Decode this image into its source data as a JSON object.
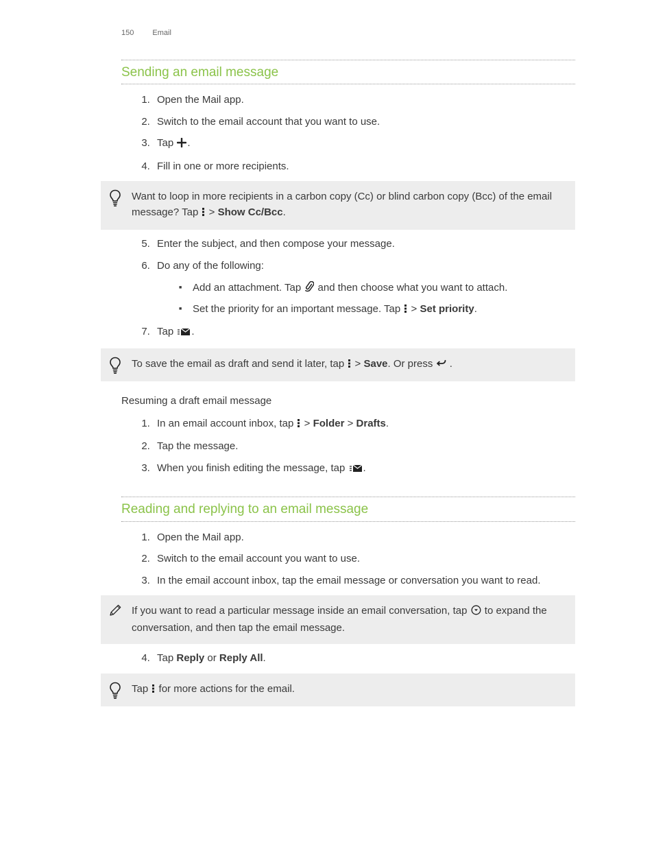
{
  "header": {
    "page_number": "150",
    "breadcrumb": "Email"
  },
  "section1": {
    "title": "Sending an email message",
    "step1": "Open the Mail app.",
    "step2": "Switch to the email account that you want to use.",
    "step3_pre": "Tap ",
    "step3_post": ".",
    "step4": "Fill in one or more recipients.",
    "tip1_pre": "Want to loop in more recipients in a carbon copy (Cc) or blind carbon copy (Bcc) of the email message? Tap ",
    "tip1_mid": " > ",
    "tip1_bold": "Show Cc/Bcc",
    "tip1_post": ".",
    "step5": "Enter the subject, and then compose your message.",
    "step6": "Do any of the following:",
    "step6a_pre": "Add an attachment. Tap ",
    "step6a_post": " and then choose what you want to attach.",
    "step6b_pre": "Set the priority for an important message. Tap ",
    "step6b_mid": " > ",
    "step6b_bold": "Set priority",
    "step6b_post": ".",
    "step7_pre": "Tap ",
    "step7_post": ".",
    "tip2_pre": "To save the email as draft and send it later, tap ",
    "tip2_mid": " > ",
    "tip2_bold": "Save",
    "tip2_post1": ". Or press ",
    "tip2_post2": " ."
  },
  "sub1": {
    "heading": "Resuming a draft email message",
    "step1_pre": "In an email account inbox, tap ",
    "step1_mid": " > ",
    "step1_b1": "Folder",
    "step1_sep": " > ",
    "step1_b2": "Drafts",
    "step1_post": ".",
    "step2": "Tap the message.",
    "step3_pre": "When you finish editing the message, tap ",
    "step3_post": "."
  },
  "section2": {
    "title": "Reading and replying to an email message",
    "step1": "Open the Mail app.",
    "step2": "Switch to the email account you want to use.",
    "step3": "In the email account inbox, tap the email message or conversation you want to read.",
    "note_pre": "If you want to read a particular message inside an email conversation, tap ",
    "note_post": " to expand the conversation, and then tap the email message.",
    "step4_pre": "Tap ",
    "step4_b1": "Reply",
    "step4_or": " or ",
    "step4_b2": "Reply All",
    "step4_post": ".",
    "tip_pre": "Tap ",
    "tip_post": " for more actions for the email."
  }
}
